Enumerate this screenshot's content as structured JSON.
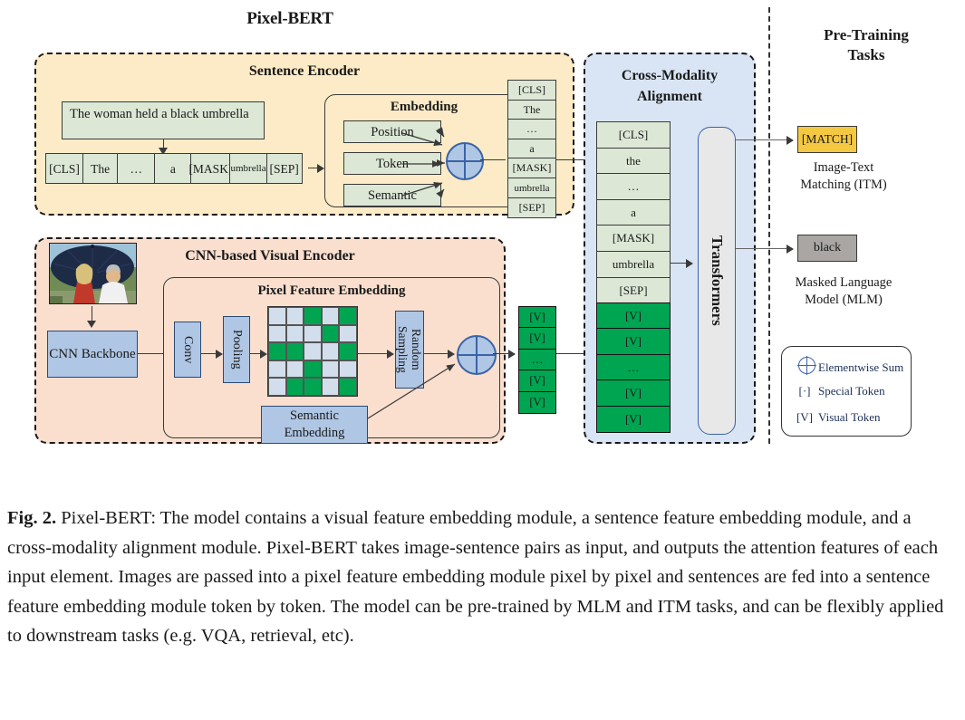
{
  "figure": {
    "main_title": "Pixel-BERT",
    "pretraining_title": "Pre-Training\nTasks"
  },
  "sentence_encoder": {
    "title": "Sentence Encoder",
    "sentence_text": "The woman held a black umbrella",
    "tokens": [
      "[CLS]",
      "The",
      "…",
      "a",
      "[MASK]",
      "umbrella",
      "[SEP]"
    ],
    "embedding": {
      "title": "Embedding",
      "items": [
        "Position",
        "Token",
        "Semantic"
      ]
    },
    "output_tokens": [
      "[CLS]",
      "The",
      "…",
      "a",
      "[MASK]",
      "umbrella",
      "[SEP]"
    ]
  },
  "visual_encoder": {
    "title": "CNN-based Visual Encoder",
    "backbone_label": "CNN Backbone",
    "pixel_feature_embedding": {
      "title": "Pixel Feature Embedding",
      "conv_label": "Conv",
      "pooling_label": "Pooling",
      "random_sampling_label": "Random Sampling",
      "semantic_embedding_label": "Semantic Embedding",
      "grid": [
        [
          "light",
          "light",
          "green",
          "light",
          "green"
        ],
        [
          "light",
          "light",
          "light",
          "green",
          "light"
        ],
        [
          "green",
          "green",
          "light",
          "light",
          "green"
        ],
        [
          "light",
          "light",
          "green",
          "light",
          "light"
        ],
        [
          "light",
          "green",
          "green",
          "light",
          "green"
        ]
      ]
    },
    "visual_tokens": [
      "[V]",
      "[V]",
      "…",
      "[V]",
      "[V]"
    ]
  },
  "cross_modality": {
    "title": "Cross-Modality\nAlignment",
    "sequence": [
      {
        "label": "[CLS]",
        "kind": "special"
      },
      {
        "label": "the",
        "kind": "text"
      },
      {
        "label": "…",
        "kind": "text"
      },
      {
        "label": "a",
        "kind": "text"
      },
      {
        "label": "[MASK]",
        "kind": "mask"
      },
      {
        "label": "umbrella",
        "kind": "text"
      },
      {
        "label": "[SEP]",
        "kind": "text"
      },
      {
        "label": "[V]",
        "kind": "visual"
      },
      {
        "label": "[V]",
        "kind": "visual"
      },
      {
        "label": "…",
        "kind": "visual"
      },
      {
        "label": "[V]",
        "kind": "visual"
      },
      {
        "label": "[V]",
        "kind": "visual"
      }
    ],
    "transformers_label": "Transformers"
  },
  "pretraining_tasks": {
    "itm": {
      "box_label": "[MATCH]",
      "caption": "Image-Text Matching (ITM)"
    },
    "mlm": {
      "box_label": "black",
      "caption": "Masked Language Model (MLM)"
    },
    "legend": [
      {
        "symbol": "sum-circle",
        "label": "Elementwise Sum"
      },
      {
        "symbol": "[·]",
        "label": "Special Token"
      },
      {
        "symbol": "[V]",
        "label": "Visual Token"
      }
    ]
  },
  "caption": {
    "label": "Fig. 2.",
    "text": " Pixel-BERT: The model contains a visual feature embedding module, a sentence feature embedding module, and a cross-modality alignment module. Pixel-BERT takes image-sentence pairs as input, and outputs the attention features of each input element. Images are passed into a pixel feature embedding module pixel by pixel and sentences are fed into a sentence feature embedding module token by token. The model can be pre-trained by MLM and ITM tasks, and can be flexibly applied to downstream tasks (e.g. VQA, retrieval, etc)."
  },
  "colors": {
    "sentence_panel_bg": "#FCEBC6",
    "visual_panel_bg": "#FADFCF",
    "cma_panel_bg": "#D9E5F4",
    "special_token": "#F5C842",
    "mask_token": "#A9A6A3",
    "text_token": "#DCE7D5",
    "visual_token": "#00A551",
    "blue_box": "#AFC6E4",
    "grid_light": "#D3DEEC",
    "transformers_bg": "#E8E8E8"
  }
}
